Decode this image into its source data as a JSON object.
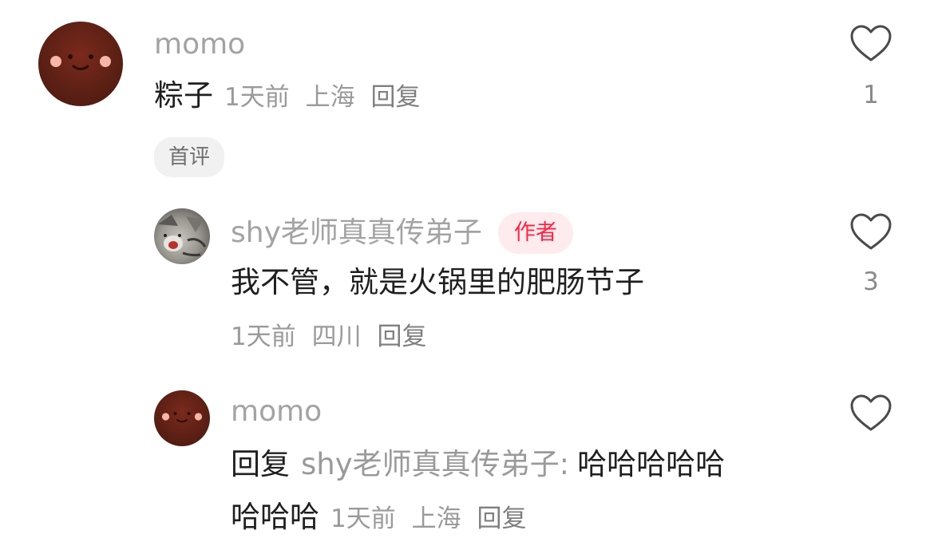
{
  "comments": [
    {
      "username": "momo",
      "text": "粽子",
      "time": "1天前",
      "location": "上海",
      "reply_label": "回复",
      "badge": "首评",
      "likes": "1"
    },
    {
      "username": "shy老师真真传弟子",
      "author_badge": "作者",
      "text": "我不管，就是火锅里的肥肠节子",
      "time": "1天前",
      "location": "四川",
      "reply_label": "回复",
      "likes": "3"
    },
    {
      "username": "momo",
      "reply_prefix": "回复",
      "reply_to": "shy老师真真传弟子:",
      "text_line1": "哈哈哈哈哈",
      "text_line2": "哈哈哈",
      "time": "1天前",
      "location": "上海",
      "reply_label": "回复"
    }
  ],
  "colors": {
    "accent_red": "#ff2442",
    "avatar_brown": "#5a1f14"
  },
  "icons": {
    "like": "heart-outline-icon",
    "avatar": "smiley-face-icon"
  }
}
